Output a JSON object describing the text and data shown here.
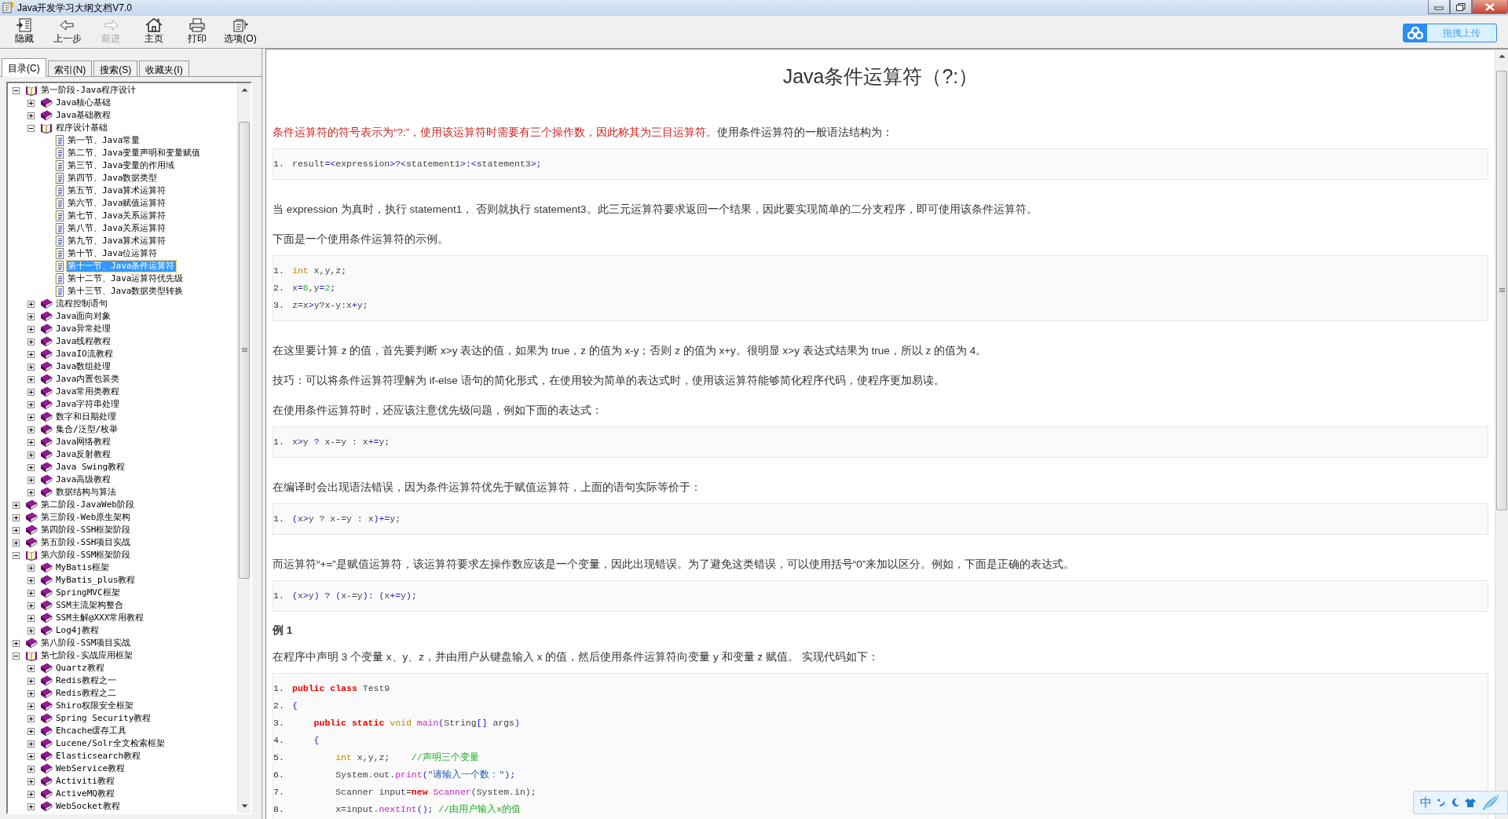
{
  "window": {
    "title": "Java开发学习大纲文档V7.0"
  },
  "toolbar": [
    {
      "label": "隐藏",
      "kind": "hide",
      "disabled": false
    },
    {
      "label": "上一步",
      "kind": "back",
      "disabled": false
    },
    {
      "label": "前进",
      "kind": "forward",
      "disabled": true
    },
    {
      "label": "主页",
      "kind": "home",
      "disabled": false
    },
    {
      "label": "打印",
      "kind": "print",
      "disabled": false
    },
    {
      "label": "选项(O)",
      "kind": "options",
      "disabled": false
    }
  ],
  "upload_button": {
    "label": "拖拽上传"
  },
  "tabs": [
    {
      "label": "目录(C)",
      "selected": true
    },
    {
      "label": "索引(N)",
      "selected": false
    },
    {
      "label": "搜索(S)",
      "selected": false
    },
    {
      "label": "收藏夹(I)",
      "selected": false
    }
  ],
  "tree": [
    {
      "label": "第一阶段-Java程序设计",
      "kind": "book",
      "expanded": true,
      "selected": false,
      "children": [
        {
          "label": "Java核心基础",
          "kind": "book",
          "expanded": false,
          "selected": false
        },
        {
          "label": "Java基础教程",
          "kind": "book",
          "expanded": false,
          "selected": false
        },
        {
          "label": "程序设计基础",
          "kind": "book",
          "expanded": true,
          "selected": false,
          "children": [
            {
              "label": "第一节、Java常量",
              "kind": "page",
              "selected": false
            },
            {
              "label": "第二节、Java变量声明和变量赋值",
              "kind": "page",
              "selected": false
            },
            {
              "label": "第三节、Java变量的作用域",
              "kind": "page",
              "selected": false
            },
            {
              "label": "第四节、Java数据类型",
              "kind": "page",
              "selected": false
            },
            {
              "label": "第五节、Java算术运算符",
              "kind": "page",
              "selected": false
            },
            {
              "label": "第六节、Java赋值运算符",
              "kind": "page",
              "selected": false
            },
            {
              "label": "第七节、Java关系运算符",
              "kind": "page",
              "selected": false
            },
            {
              "label": "第八节、Java关系运算符",
              "kind": "page",
              "selected": false
            },
            {
              "label": "第九节、Java算术运算符",
              "kind": "page",
              "selected": false
            },
            {
              "label": "第十节、Java位运算符",
              "kind": "page",
              "selected": false
            },
            {
              "label": "第十一节、Java条件运算符",
              "kind": "page",
              "selected": true
            },
            {
              "label": "第十二节、Java运算符优先级",
              "kind": "page",
              "selected": false
            },
            {
              "label": "第十三节、Java数据类型转换",
              "kind": "page",
              "selected": false
            }
          ]
        },
        {
          "label": "流程控制语句",
          "kind": "book",
          "expanded": false,
          "selected": false
        },
        {
          "label": "Java面向对象",
          "kind": "book",
          "expanded": false,
          "selected": false
        },
        {
          "label": "Java异常处理",
          "kind": "book",
          "expanded": false,
          "selected": false
        },
        {
          "label": "Java线程教程",
          "kind": "book",
          "expanded": false,
          "selected": false
        },
        {
          "label": "JavaIO流教程",
          "kind": "book",
          "expanded": false,
          "selected": false
        },
        {
          "label": "Java数组处理",
          "kind": "book",
          "expanded": false,
          "selected": false
        },
        {
          "label": "Java内置包装类",
          "kind": "book",
          "expanded": false,
          "selected": false
        },
        {
          "label": "Java常用类教程",
          "kind": "book",
          "expanded": false,
          "selected": false
        },
        {
          "label": "Java字符串处理",
          "kind": "book",
          "expanded": false,
          "selected": false
        },
        {
          "label": "数字和日期处理",
          "kind": "book",
          "expanded": false,
          "selected": false
        },
        {
          "label": "集合/泛型/枚举",
          "kind": "book",
          "expanded": false,
          "selected": false
        },
        {
          "label": "Java网络教程",
          "kind": "book",
          "expanded": false,
          "selected": false
        },
        {
          "label": "Java反射教程",
          "kind": "book",
          "expanded": false,
          "selected": false
        },
        {
          "label": "Java Swing教程",
          "kind": "book",
          "expanded": false,
          "selected": false
        },
        {
          "label": "Java高级教程",
          "kind": "book",
          "expanded": false,
          "selected": false
        },
        {
          "label": "数据结构与算法",
          "kind": "book",
          "expanded": false,
          "selected": false
        }
      ]
    },
    {
      "label": "第二阶段-JavaWeb阶段",
      "kind": "book",
      "expanded": false,
      "selected": false
    },
    {
      "label": "第三阶段-Web原生架构",
      "kind": "book",
      "expanded": false,
      "selected": false
    },
    {
      "label": "第四阶段-SSH框架阶段",
      "kind": "book",
      "expanded": false,
      "selected": false
    },
    {
      "label": "第五阶段-SSH项目实战",
      "kind": "book",
      "expanded": false,
      "selected": false
    },
    {
      "label": "第六阶段-SSM框架阶段",
      "kind": "book",
      "expanded": true,
      "selected": false,
      "children": [
        {
          "label": "MyBatis框架",
          "kind": "book",
          "expanded": false,
          "selected": false
        },
        {
          "label": "MyBatis_plus教程",
          "kind": "book",
          "expanded": false,
          "selected": false
        },
        {
          "label": "SpringMVC框架",
          "kind": "book",
          "expanded": false,
          "selected": false
        },
        {
          "label": "SSM主流架构整合",
          "kind": "book",
          "expanded": false,
          "selected": false
        },
        {
          "label": "SSM主解@XXX常用教程",
          "kind": "book",
          "expanded": false,
          "selected": false
        },
        {
          "label": "Log4j教程",
          "kind": "book",
          "expanded": false,
          "selected": false
        }
      ]
    },
    {
      "label": "第八阶段-SSM项目实战",
      "kind": "book",
      "expanded": false,
      "selected": false
    },
    {
      "label": "第七阶段-实战应用框架",
      "kind": "book",
      "expanded": true,
      "selected": false,
      "children": [
        {
          "label": "Quartz教程",
          "kind": "book",
          "expanded": false,
          "selected": false
        },
        {
          "label": "Redis教程之一",
          "kind": "book",
          "expanded": false,
          "selected": false
        },
        {
          "label": "Redis教程之二",
          "kind": "book",
          "expanded": false,
          "selected": false
        },
        {
          "label": "Shiro权限安全框架",
          "kind": "book",
          "expanded": false,
          "selected": false
        },
        {
          "label": "Spring Security教程",
          "kind": "book",
          "expanded": false,
          "selected": false
        },
        {
          "label": "Ehcache缓存工具",
          "kind": "book",
          "expanded": false,
          "selected": false
        },
        {
          "label": "Lucene/Solr全文检索框架",
          "kind": "book",
          "expanded": false,
          "selected": false
        },
        {
          "label": "Elasticsearch教程",
          "kind": "book",
          "expanded": false,
          "selected": false
        },
        {
          "label": "WebService教程",
          "kind": "book",
          "expanded": false,
          "selected": false
        },
        {
          "label": "Activiti教程",
          "kind": "book",
          "expanded": false,
          "selected": false
        },
        {
          "label": "ActiveMQ教程",
          "kind": "book",
          "expanded": false,
          "selected": false
        },
        {
          "label": "WebSocket教程",
          "kind": "book",
          "expanded": false,
          "selected": false
        }
      ]
    }
  ],
  "article": {
    "title": "Java条件运算符（?:）",
    "blocks": [
      {
        "kind": "para",
        "segments": [
          {
            "text": "条件运算符的符号表示为“?:”，使用该运算符时需要有三个操作数，因此称其为三目运算符。",
            "highlighted": true
          },
          {
            "text": "使用条件运算符的一般语法结构为：",
            "highlighted": false
          }
        ]
      },
      {
        "kind": "code",
        "lines": [
          {
            "no": "1.",
            "tokens": [
              {
                "text": "result",
                "kind": "plain"
              },
              {
                "text": "=<",
                "kind": "op"
              },
              {
                "text": "expression",
                "kind": "plain"
              },
              {
                "text": ">?<",
                "kind": "op"
              },
              {
                "text": "statement1",
                "kind": "plain"
              },
              {
                "text": ">:<",
                "kind": "op"
              },
              {
                "text": "statement3",
                "kind": "plain"
              },
              {
                "text": ">;",
                "kind": "op"
              }
            ]
          }
        ]
      },
      {
        "kind": "para",
        "segments": [
          {
            "text": "当 expression 为真时，执行 statement1， 否则就执行 statement3。此三元运算符要求返回一个结果，因此要实现简单的二分支程序，即可使用该条件运算符。",
            "highlighted": false
          }
        ]
      },
      {
        "kind": "para",
        "segments": [
          {
            "text": "下面是一个使用条件运算符的示例。",
            "highlighted": false
          }
        ]
      },
      {
        "kind": "code",
        "lines": [
          {
            "no": "1.",
            "tokens": [
              {
                "text": "int",
                "kind": "type"
              },
              {
                "text": " x,y,z;",
                "kind": "plain"
              }
            ]
          },
          {
            "no": "2.",
            "tokens": [
              {
                "text": "x",
                "kind": "plain"
              },
              {
                "text": "=",
                "kind": "op"
              },
              {
                "text": "6",
                "kind": "num"
              },
              {
                "text": ",y",
                "kind": "plain"
              },
              {
                "text": "=",
                "kind": "op"
              },
              {
                "text": "2",
                "kind": "num"
              },
              {
                "text": ";",
                "kind": "op"
              }
            ]
          },
          {
            "no": "3.",
            "tokens": [
              {
                "text": "z=x",
                "kind": "plain"
              },
              {
                "text": ">",
                "kind": "op"
              },
              {
                "text": "y?x-y:x",
                "kind": "plain"
              },
              {
                "text": "+",
                "kind": "op"
              },
              {
                "text": "y;",
                "kind": "plain"
              }
            ]
          }
        ]
      },
      {
        "kind": "para",
        "segments": [
          {
            "text": "在这里要计算 z 的值，首先要判断 x>y 表达的值，如果为 true，z 的值为 x-y；否则 z 的值为 x+y。很明显 x>y 表达式结果为 true，所以 z 的值为 4。",
            "highlighted": false
          }
        ]
      },
      {
        "kind": "para",
        "segments": [
          {
            "text": "技巧：可以将条件运算符理解为 if-else 语句的简化形式，在使用较为简单的表达式时，使用该运算符能够简化程序代码，使程序更加易读。",
            "highlighted": false
          }
        ]
      },
      {
        "kind": "para",
        "segments": [
          {
            "text": "在使用条件运算符时，还应该注意优先级问题，例如下面的表达式：",
            "highlighted": false
          }
        ]
      },
      {
        "kind": "code",
        "lines": [
          {
            "no": "1.",
            "tokens": [
              {
                "text": "x",
                "kind": "plain"
              },
              {
                "text": ">",
                "kind": "op"
              },
              {
                "text": "y ",
                "kind": "plain"
              },
              {
                "text": "?",
                "kind": "op"
              },
              {
                "text": " x-=y : x",
                "kind": "plain"
              },
              {
                "text": "+=",
                "kind": "op"
              },
              {
                "text": "y;",
                "kind": "plain"
              }
            ]
          }
        ]
      },
      {
        "kind": "para",
        "segments": [
          {
            "text": "在编译时会出现语法错误，因为条件运算符优先于赋值运算符，上面的语句实际等价于：",
            "highlighted": false
          }
        ]
      },
      {
        "kind": "code",
        "lines": [
          {
            "no": "1.",
            "tokens": [
              {
                "text": "(",
                "kind": "op"
              },
              {
                "text": "x",
                "kind": "plain"
              },
              {
                "text": ">",
                "kind": "op"
              },
              {
                "text": "y ? x-=y : x",
                "kind": "plain"
              },
              {
                "text": ")+=",
                "kind": "op"
              },
              {
                "text": "y;",
                "kind": "plain"
              }
            ]
          }
        ]
      },
      {
        "kind": "para",
        "segments": [
          {
            "text": "而运算符“+=”是赋值运算符，该运算符要求左操作数应该是一个变量，因此出现错误。为了避免这类错误，可以使用括号“0”来加以区分。例如，下面是正确的表达式。",
            "highlighted": false
          }
        ]
      },
      {
        "kind": "code",
        "lines": [
          {
            "no": "1.",
            "tokens": [
              {
                "text": "(",
                "kind": "op"
              },
              {
                "text": "x",
                "kind": "plain"
              },
              {
                "text": ">",
                "kind": "op"
              },
              {
                "text": "y",
                "kind": "plain"
              },
              {
                "text": ") ? (",
                "kind": "op"
              },
              {
                "text": "x-=y",
                "kind": "plain"
              },
              {
                "text": "): (",
                "kind": "op"
              },
              {
                "text": "x",
                "kind": "plain"
              },
              {
                "text": "+=",
                "kind": "op"
              },
              {
                "text": "y",
                "kind": "plain"
              },
              {
                "text": ");",
                "kind": "op"
              }
            ]
          }
        ]
      },
      {
        "kind": "heading",
        "text": "例 1"
      },
      {
        "kind": "para",
        "segments": [
          {
            "text": "在程序中声明 3 个变量 x、y、z，并由用户从键盘输入 x 的值，然后使用条件运算符向变量 y 和变量 z 赋值。 实现代码如下：",
            "highlighted": false
          }
        ]
      },
      {
        "kind": "code",
        "lines": [
          {
            "no": "1.",
            "tokens": [
              {
                "text": "public class",
                "kind": "kw"
              },
              {
                "text": " Test9",
                "kind": "plain"
              }
            ]
          },
          {
            "no": "2.",
            "tokens": [
              {
                "text": "{",
                "kind": "op"
              }
            ]
          },
          {
            "no": "3.",
            "tokens": [
              {
                "text": "    public static",
                "kind": "kw"
              },
              {
                "text": " void",
                "kind": "type"
              },
              {
                "text": " main",
                "kind": "func"
              },
              {
                "text": "(",
                "kind": "op"
              },
              {
                "text": "String",
                "kind": "plain"
              },
              {
                "text": "[]",
                "kind": "op"
              },
              {
                "text": " args",
                "kind": "plain"
              },
              {
                "text": ")",
                "kind": "op"
              }
            ]
          },
          {
            "no": "4.",
            "tokens": [
              {
                "text": "    {",
                "kind": "op"
              }
            ]
          },
          {
            "no": "5.",
            "tokens": [
              {
                "text": "        int",
                "kind": "type"
              },
              {
                "text": " x,y,z;",
                "kind": "plain"
              },
              {
                "text": "    //声明三个变量",
                "kind": "cmt"
              }
            ]
          },
          {
            "no": "6.",
            "tokens": [
              {
                "text": "        System.out.",
                "kind": "plain"
              },
              {
                "text": "print",
                "kind": "func"
              },
              {
                "text": "(",
                "kind": "op"
              },
              {
                "text": "\"请输入一个数：\"",
                "kind": "str"
              },
              {
                "text": ");",
                "kind": "op"
              }
            ]
          },
          {
            "no": "7.",
            "tokens": [
              {
                "text": "        Scanner input=",
                "kind": "plain"
              },
              {
                "text": "new",
                "kind": "kw"
              },
              {
                "text": " Scanner",
                "kind": "func"
              },
              {
                "text": "(System.in);",
                "kind": "plain"
              }
            ]
          },
          {
            "no": "8.",
            "tokens": [
              {
                "text": "        x=input.",
                "kind": "plain"
              },
              {
                "text": "nextInt",
                "kind": "func"
              },
              {
                "text": "();",
                "kind": "op"
              },
              {
                "text": " //由用户输入x的值",
                "kind": "cmt"
              }
            ]
          }
        ]
      }
    ]
  },
  "ime": {
    "label": "中"
  }
}
